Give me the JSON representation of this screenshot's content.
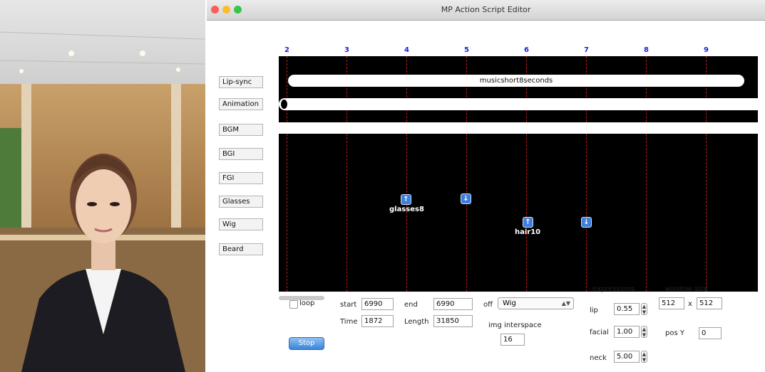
{
  "window": {
    "title": "MP Action Script Editor"
  },
  "colors": {
    "timeline_bg": "#000000",
    "marker_line": "#c01818",
    "ruler_text": "#2222dd",
    "accent_button": "#3b83d8"
  },
  "tracks": [
    "Lip-sync",
    "Animation",
    "BGM",
    "BGI",
    "FGI",
    "Glasses",
    "Wig",
    "Beard"
  ],
  "ruler": {
    "ticks": [
      "2",
      "3",
      "4",
      "5",
      "6",
      "7",
      "8",
      "9"
    ]
  },
  "timeline": {
    "lip_clip_label": "musicshort8seconds",
    "events": [
      {
        "icon": "up-arrow-icon",
        "label": "glasses8"
      },
      {
        "icon": "down-arrow-icon",
        "label": ""
      },
      {
        "icon": "up-arrow-icon",
        "label": "hair10"
      },
      {
        "icon": "down-arrow-icon",
        "label": ""
      }
    ]
  },
  "controls": {
    "loop_label": "loop",
    "stop_label": "Stop",
    "start_label": "start",
    "start_value": "6990",
    "end_label": "end",
    "end_value": "6990",
    "time_label": "Time",
    "time_value": "1872",
    "length_label": "Length",
    "length_value": "31850",
    "off_label": "off",
    "layer_select": "Wig",
    "img_interspace_label": "img interspace",
    "img_interspace_value": "16",
    "expressions_label": "expressions",
    "lip_label": "lip",
    "lip_value": "0.55",
    "facial_label": "facial",
    "facial_value": "1.00",
    "neck_label": "neck",
    "neck_value": "5.00",
    "window_size_label": "window size",
    "width_value": "512",
    "times": "x",
    "height_value": "512",
    "posy_label": "pos Y",
    "posy_value": "0"
  }
}
